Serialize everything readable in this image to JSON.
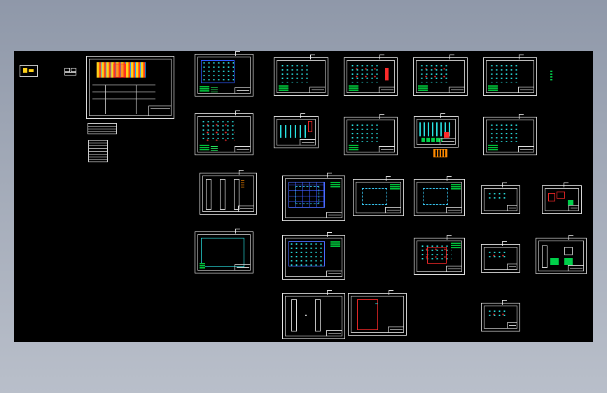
{
  "app": {
    "viewport_label": ""
  },
  "colors": {
    "canvas_bg": "#000000",
    "desktop_bg": "#a9b0bd",
    "sheet_border": "#e8e8e8",
    "plan_cyan": "#29e3e3",
    "plan_red": "#ff2a2a",
    "legend_green": "#00c23a",
    "grid_blue": "#4a6cff"
  },
  "icons": [
    "drawing-thumbnail-icon",
    "block-reference-icon"
  ],
  "sheets": [
    {
      "name": "sheet-r1c1",
      "kind": "cyan-plan"
    },
    {
      "name": "sheet-r1c2",
      "kind": "cyan-plan"
    },
    {
      "name": "sheet-r1c3",
      "kind": "cyan-red-plan"
    },
    {
      "name": "sheet-r1c4",
      "kind": "cyan-red-plan"
    },
    {
      "name": "sheet-r1c5",
      "kind": "cyan-plan"
    },
    {
      "name": "sheet-r2c1",
      "kind": "cyan-red-plan"
    },
    {
      "name": "sheet-r2c2",
      "kind": "columns"
    },
    {
      "name": "sheet-r2c3",
      "kind": "cyan-plan"
    },
    {
      "name": "sheet-r2c4",
      "kind": "details"
    },
    {
      "name": "sheet-r2c5",
      "kind": "cyan-plan"
    },
    {
      "name": "sheet-r3c1",
      "kind": "elevation"
    },
    {
      "name": "sheet-r3c2",
      "kind": "grid-plan"
    },
    {
      "name": "sheet-r3c3",
      "kind": "ring-plan"
    },
    {
      "name": "sheet-r3c4",
      "kind": "ring-plan"
    },
    {
      "name": "sheet-r3c5",
      "kind": "small-plan"
    },
    {
      "name": "sheet-r3c6",
      "kind": "small-detail"
    },
    {
      "name": "sheet-r4c1",
      "kind": "outline"
    },
    {
      "name": "sheet-r4c2",
      "kind": "grid-plan"
    },
    {
      "name": "sheet-r4c4",
      "kind": "red-plan"
    },
    {
      "name": "sheet-r4c5",
      "kind": "small-plan"
    },
    {
      "name": "sheet-r4c6",
      "kind": "detail"
    },
    {
      "name": "sheet-r5c2",
      "kind": "elevation"
    },
    {
      "name": "sheet-r5c3",
      "kind": "red-outline"
    },
    {
      "name": "sheet-r5c5",
      "kind": "small-plan"
    }
  ]
}
